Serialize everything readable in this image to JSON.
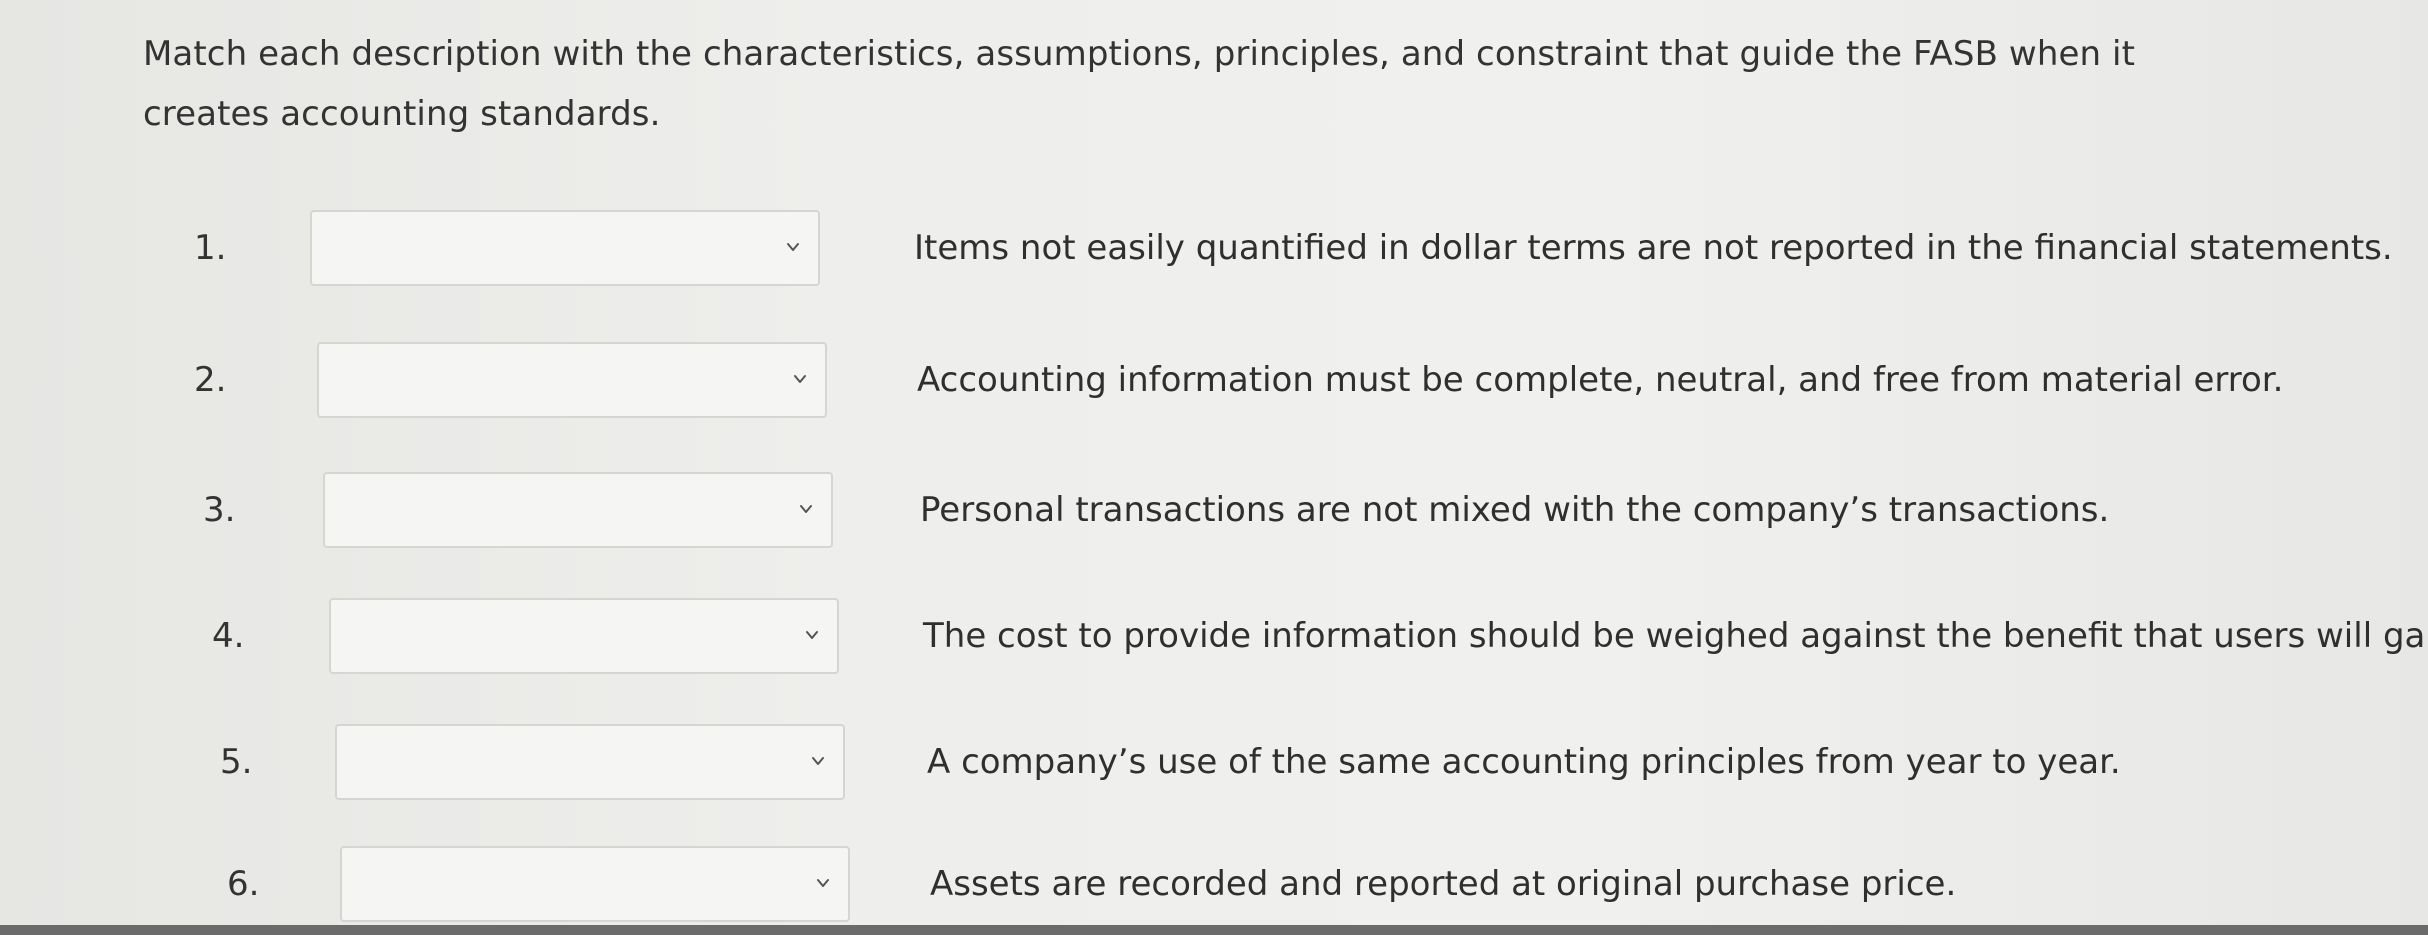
{
  "prompt": {
    "text": "Match each description with the characteristics, assumptions, principles, and constraint that guide the FASB when it creates accounting standards."
  },
  "rows": [
    {
      "number": "1.",
      "selected": "",
      "description": "Items not easily quantified in dollar terms are not reported in the financial statements."
    },
    {
      "number": "2.",
      "selected": "",
      "description": "Accounting information must be complete, neutral, and free from material error."
    },
    {
      "number": "3.",
      "selected": "",
      "description": "Personal transactions are not mixed with the company’s transactions."
    },
    {
      "number": "4.",
      "selected": "",
      "description": "The cost to provide information should be weighed against the benefit that users will gai"
    },
    {
      "number": "5.",
      "selected": "",
      "description": "A company’s use of the same accounting principles from year to year."
    },
    {
      "number": "6.",
      "selected": "",
      "description": "Assets are recorded and reported at original purchase price."
    }
  ],
  "icons": {
    "dropdown": "chevron-down-icon"
  }
}
